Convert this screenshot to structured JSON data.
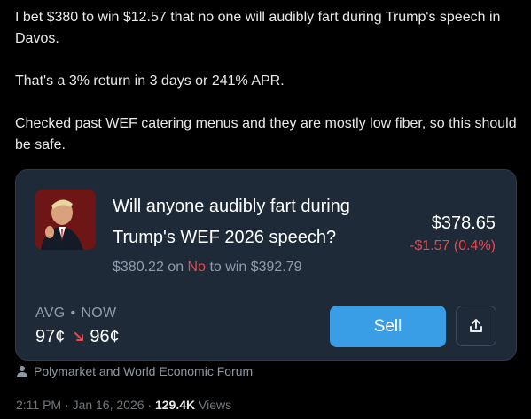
{
  "tweet": {
    "paragraphs": [
      "I bet $380 to win $12.57 that no one will audibly fart during Trump's speech in Davos.",
      "That's a 3% return in 3 days or 241% APR.",
      "Checked past WEF catering menus and they are mostly low fiber, so this should be safe."
    ]
  },
  "card": {
    "question": "Will anyone audibly fart during Trump's WEF 2026 speech?",
    "position_amount": "$380.22",
    "position_on": "on",
    "position_side": "No",
    "position_to_win": "to win $392.79",
    "price": "$378.65",
    "change": "-$1.57 (0.4%)",
    "avg_label": "AVG",
    "avg_separator": "•",
    "now_label": "NOW",
    "avg_value": "97¢",
    "now_value": "96¢",
    "sell_label": "Sell",
    "icons": {
      "thumbnail": "market-thumbnail",
      "trend": "trend-down-arrow-icon",
      "share": "share-icon"
    }
  },
  "attribution": {
    "text": "Polymarket and World Economic Forum",
    "icon": "person-icon"
  },
  "meta": {
    "time": "2:11 PM",
    "date": "Jan 16, 2026",
    "views_count": "129.4K",
    "views_label": "Views"
  },
  "colors": {
    "background": "#000000",
    "card_background": "#1e2a38",
    "accent_blue": "#3a9ee6",
    "negative_red": "#e5484d",
    "muted_text": "#8f9cab"
  }
}
